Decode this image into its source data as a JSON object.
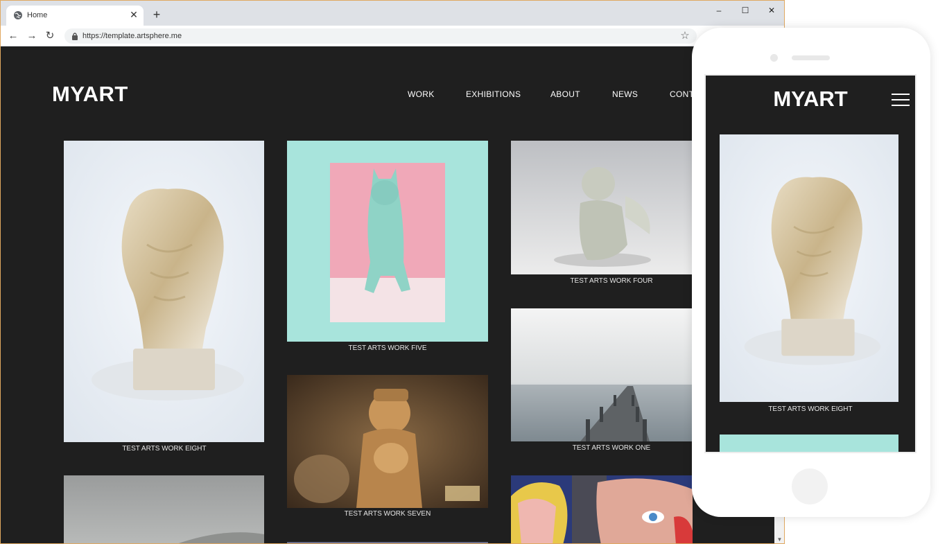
{
  "browser": {
    "tab_title": "Home",
    "url": "https://template.artsphere.me",
    "controls": {
      "minimize": "–",
      "maximize": "☐",
      "close": "✕"
    }
  },
  "site": {
    "logo": "MYART",
    "nav": [
      "WORK",
      "EXHIBITIONS",
      "ABOUT",
      "NEWS",
      "CONT"
    ]
  },
  "gallery": [
    {
      "caption": "TEST ARTS WORK EIGHT",
      "art": "torso-sculpture"
    },
    {
      "caption": "TEST ARTS WORK FIVE",
      "art": "mint-cat-figurine"
    },
    {
      "caption": "TEST ARTS WORK FOUR",
      "art": "cherub-statue"
    },
    {
      "caption": "TEST ARTS WORK SEVEN",
      "art": "wooden-carving"
    },
    {
      "caption": "TEST ARTS WORK ONE",
      "art": "pier-in-fog"
    },
    {
      "caption": "",
      "art": "misty-landscape"
    },
    {
      "caption": "",
      "art": "pop-art-faces"
    }
  ],
  "mobile": {
    "logo": "MYART",
    "caption": "TEST ARTS WORK EIGHT"
  },
  "colors": {
    "page_bg": "#1f1f1f",
    "text": "#ffffff",
    "mint": "#a8e4dc",
    "pink": "#f0a8b8"
  }
}
